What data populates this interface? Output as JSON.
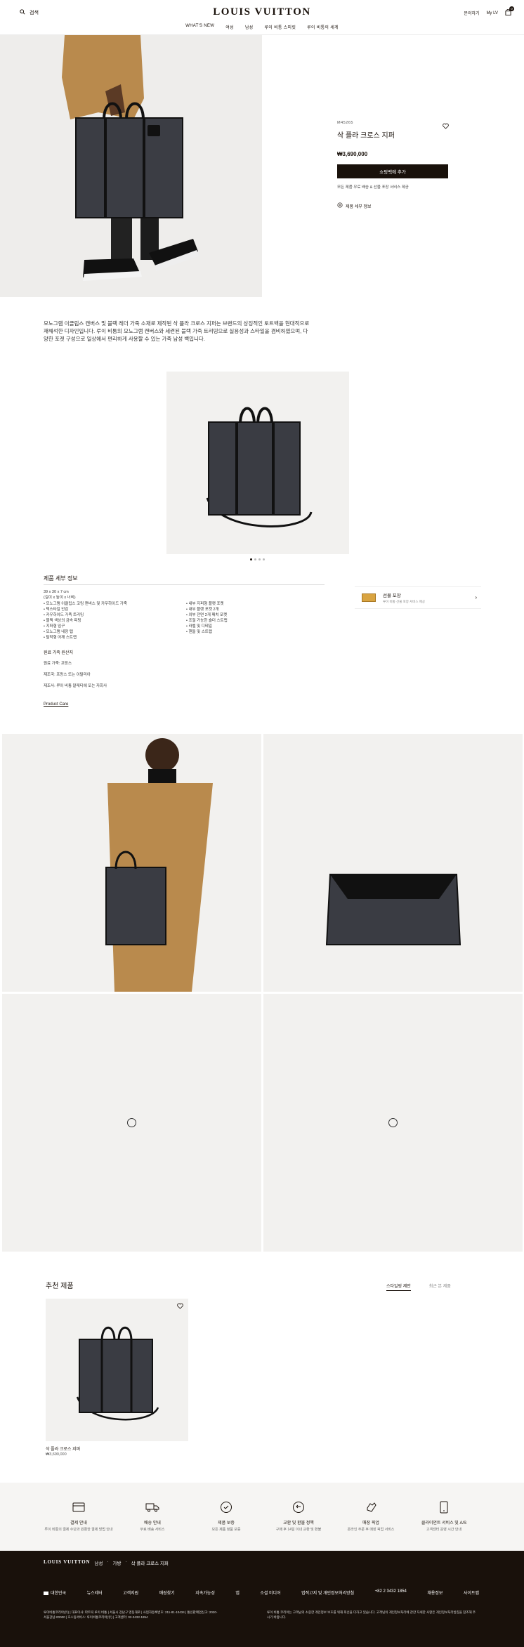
{
  "header": {
    "search_label": "검색",
    "logo": "LOUIS VUITTON",
    "nav": [
      "WHAT'S NEW",
      "여성",
      "남성",
      "루이 비통 스피릿",
      "루이 비통의 세계"
    ],
    "contact_label": "문의하기",
    "account_label": "My LV",
    "bag_count": "0"
  },
  "product": {
    "sku": "M45265",
    "title": "삭 플라 크로스 지퍼",
    "price": "₩3,690,000",
    "add_button": "쇼핑백에 추가",
    "ship_note": "모든 제품 무료 배송 & 선물 포장 서비스 제공",
    "details_link": "제품 세부 정보"
  },
  "description": "모노그램 이클립스 캔버스 및 블랙 레더 가죽 소재로 제작된 삭 플라 크로스 지퍼는 브랜드의 상징적인 토트백을 현대적으로 재해석한 디자인입니다. 루이 비통의 모노그램 캔버스와 세련된 블랙 가죽 트리밍으로 실용성과 스타일을 겸비하였으며, 다양한 포켓 구성으로 일상에서 편리하게 사용할 수 있는 가죽 남성 백입니다.",
  "specs": {
    "title": "제품 세부 정보",
    "dims": [
      "39 x 30 x 7 cm",
      "(길이 x 높이 x 너비)"
    ],
    "left": [
      "모노그램 이클립스 코팅 캔버스 및 카우하이드 가죽",
      "텍스타일 안감",
      "카우하이드 가죽 트리밍",
      "블랙 색상의 금속 피팅",
      "지퍼형 입구",
      "모노그램 내장 탭",
      "탈착형 어깨 스트랩"
    ],
    "right": [
      "내부 지퍼형 플랫 포켓",
      "내부 플랫 포켓 2개",
      "외부 전면 2개 패치 포켓",
      "조절 가능한 숄더 스트랩",
      "라벨 및 디테일",
      "핸들 및 스트랩"
    ],
    "origin_title": "원료 가죽 원산지",
    "origin": [
      "원료 가죽: 프랑스",
      "제조국: 프랑스 또는 이탈리아",
      "제조사: 루이 비통 말레티에 또는 자회사"
    ],
    "care_link": "Product Care"
  },
  "packaging": {
    "title": "선물 포장",
    "sub": "루이 비통 선물 포장 서비스 제공"
  },
  "recommended": {
    "title": "추천 제품",
    "tab_1": "스타일링 제안",
    "tab_2": "최근 본 제품",
    "item_name": "삭 플라 크로스 지퍼",
    "item_price": "₩3,690,000"
  },
  "services": [
    {
      "label": "결제 안내",
      "sub": "루이 비통의 결제 수단과 원활한 결제 방법 안내"
    },
    {
      "label": "배송 안내",
      "sub": "무료 배송 서비스"
    },
    {
      "label": "제품 보증",
      "sub": "모든 제품 정품 보증"
    },
    {
      "label": "교환 및 환불 정책",
      "sub": "구매 후 14일 이내 교환 및 환불"
    },
    {
      "label": "매장 픽업",
      "sub": "온라인 주문 후 매장 픽업 서비스"
    },
    {
      "label": "클라이언트 서비스 및 A/S",
      "sub": "고객센터 운영 시간 안내"
    }
  ],
  "footer": {
    "logo": "LOUIS VUITTON",
    "crumb": [
      "남성",
      "가방",
      "삭 플라 크로스 지퍼"
    ],
    "links": [
      "대한민국",
      "뉴스레터",
      "고객지원",
      "매장찾기",
      "지속가능성",
      "앱",
      "소셜 미디어",
      "법적고지 및 개인정보처리방침",
      "+82 2 3432 1854",
      "채용정보",
      "사이트맵"
    ],
    "legal_left": "루이비통코리아(유) | 대표이사: 파트릭 루이 비통 | 서울시 강남구 영동대로 | 사업자등록번호: 211-81-10434 | 통신판매업신고: 2020-서울강남-00000 | 호스팅서비스: 루이비통코리아(유) | 고객센터: 02-3432-1854",
    "legal_right": "루이 비통 코리아는 고객님의 소중한 개인정보 보호를 위해 최선을 다하고 있습니다. 고객님의 개인정보처리에 관한 자세한 사항은 개인정보처리방침을 참조해 주시기 바랍니다."
  }
}
